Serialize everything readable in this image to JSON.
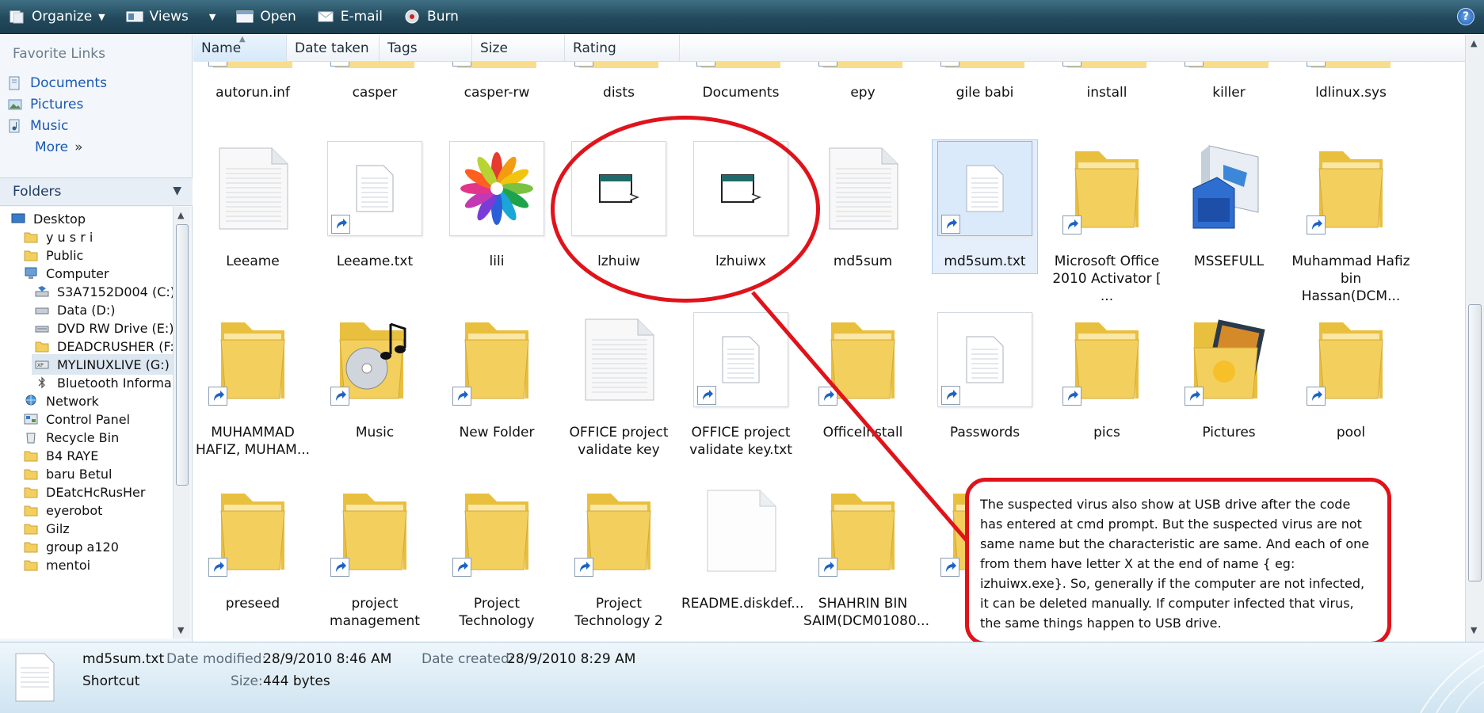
{
  "toolbar": {
    "organize": "Organize",
    "views": "Views",
    "open": "Open",
    "email": "E-mail",
    "burn": "Burn",
    "help": "?"
  },
  "favorite_links": {
    "title": "Favorite Links",
    "items": [
      "Documents",
      "Pictures",
      "Music"
    ],
    "more": "More",
    "more_glyph": "»"
  },
  "folders": {
    "title": "Folders",
    "tree": [
      {
        "label": "Desktop",
        "icon": "desktop-icon"
      },
      {
        "label": "y u s r i",
        "icon": "folder-icon"
      },
      {
        "label": "Public",
        "icon": "folder-icon"
      },
      {
        "label": "Computer",
        "icon": "computer-icon"
      },
      {
        "label": "S3A7152D004 (C:)",
        "icon": "drive-icon"
      },
      {
        "label": "Data (D:)",
        "icon": "drive-icon"
      },
      {
        "label": "DVD RW Drive (E:)",
        "icon": "dvd-drive-icon"
      },
      {
        "label": "DEADCRUSHER (F:",
        "icon": "folder-icon"
      },
      {
        "label": "MYLINUXLIVE (G:)",
        "icon": "usb-drive-icon",
        "selected": true
      },
      {
        "label": "Bluetooth Informa",
        "icon": "bluetooth-icon"
      },
      {
        "label": "Network",
        "icon": "network-icon"
      },
      {
        "label": "Control Panel",
        "icon": "control-panel-icon"
      },
      {
        "label": "Recycle Bin",
        "icon": "recycle-bin-icon"
      },
      {
        "label": "B4 RAYE",
        "icon": "folder-icon"
      },
      {
        "label": "baru Betul",
        "icon": "folder-icon"
      },
      {
        "label": "DEatcHcRusHer",
        "icon": "folder-icon"
      },
      {
        "label": "eyerobot",
        "icon": "folder-icon"
      },
      {
        "label": "Gilz",
        "icon": "folder-icon"
      },
      {
        "label": "group a120",
        "icon": "folder-icon"
      },
      {
        "label": "mentoi",
        "icon": "folder-icon"
      }
    ]
  },
  "columns": [
    "Name",
    "Date taken",
    "Tags",
    "Size",
    "Rating"
  ],
  "items_row0": [
    "autorun.inf",
    "casper",
    "casper-rw",
    "dists",
    "Documents",
    "epy",
    "gile babi",
    "install",
    "killer",
    "ldlinux.sys"
  ],
  "items_row1": [
    {
      "label": "Leeame",
      "kind": "doc"
    },
    {
      "label": "Leeame.txt",
      "kind": "txt-shortcut"
    },
    {
      "label": "lili",
      "kind": "flower"
    },
    {
      "label": "lzhuiw",
      "kind": "app"
    },
    {
      "label": "lzhuiwx",
      "kind": "app"
    },
    {
      "label": "md5sum",
      "kind": "doc"
    },
    {
      "label": "md5sum.txt",
      "kind": "txt-shortcut",
      "selected": true
    },
    {
      "label": "Microsoft Office 2010 Activator [ ...",
      "kind": "folder-shortcut"
    },
    {
      "label": "MSSEFULL",
      "kind": "installer"
    },
    {
      "label": "Muhammad Hafiz bin Hassan(DCM...",
      "kind": "folder-shortcut"
    }
  ],
  "items_row2": [
    {
      "label": "MUHAMMAD HAFIZ, MUHAM...",
      "kind": "folder-shortcut"
    },
    {
      "label": "Music",
      "kind": "music-folder-shortcut"
    },
    {
      "label": "New Folder",
      "kind": "folder-shortcut"
    },
    {
      "label": "OFFICE project validate key",
      "kind": "doc"
    },
    {
      "label": "OFFICE project validate key.txt",
      "kind": "txt-shortcut"
    },
    {
      "label": "OfficeInstall",
      "kind": "folder-shortcut"
    },
    {
      "label": "Passwords",
      "kind": "txt-shortcut"
    },
    {
      "label": "pics",
      "kind": "folder-shortcut"
    },
    {
      "label": "Pictures",
      "kind": "pictures-folder-shortcut"
    },
    {
      "label": "pool",
      "kind": "folder-shortcut"
    }
  ],
  "items_row3": [
    {
      "label": "preseed",
      "kind": "folder-shortcut"
    },
    {
      "label": "project management",
      "kind": "folder-shortcut"
    },
    {
      "label": "Project Technology",
      "kind": "folder-shortcut"
    },
    {
      "label": "Project Technology 2",
      "kind": "folder-shortcut"
    },
    {
      "label": "README.diskdef...",
      "kind": "blank-doc"
    },
    {
      "label": "SHAHRIN BIN SAIM(DCM01080...",
      "kind": "folder-shortcut"
    },
    {
      "label": "",
      "kind": "folder-shortcut"
    }
  ],
  "annotation": {
    "text": "The suspected virus also show at USB drive after the code has entered at cmd prompt. But the suspected virus are not same name but the characteristic are same. And each of one from them have letter X at the end of name { eg: izhuiwx.exe}. So, generally if the computer are not infected, it can be deleted manually. If computer infected that virus, the same things happen to USB drive.",
    "color": "#e0131b"
  },
  "details": {
    "name": "md5sum.txt",
    "type": "Shortcut",
    "date_modified_label": "Date modified:",
    "date_modified": "28/9/2010 8:46 AM",
    "size_label": "Size:",
    "size": "444 bytes",
    "date_created_label": "Date created:",
    "date_created": "28/9/2010 8:29 AM"
  },
  "colors": {
    "toolbar": "#22495c",
    "link": "#1b59b3",
    "folder": "#f3cf5d",
    "selection": "#dbeafa"
  }
}
